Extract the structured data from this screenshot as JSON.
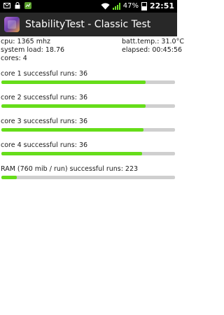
{
  "status_bar": {
    "battery_percent": "47%",
    "time": "22:51",
    "icons": [
      "mail-icon",
      "lock-icon",
      "app-notification-icon",
      "wifi-icon",
      "signal-icon",
      "battery-icon"
    ]
  },
  "action_bar": {
    "title": "StabilityTest - Classic Test"
  },
  "info": {
    "cpu": "cpu: 1365 mhz",
    "batt_temp": "batt.temp.: 31.0°C",
    "system_load": "system load: 18.76",
    "elapsed": "elapsed: 00:45:56",
    "cores": "cores: 4"
  },
  "sections": [
    {
      "label": "core 1 successful runs: 36",
      "progress": 0.83
    },
    {
      "label": "core 2 successful runs: 36",
      "progress": 0.83
    },
    {
      "label": "core 3 successful runs: 36",
      "progress": 0.82
    },
    {
      "label": "core 4 successful runs: 36",
      "progress": 0.81
    },
    {
      "label": "RAM (760 mib / run) successful runs: 223",
      "progress": 0.09
    }
  ],
  "colors": {
    "progress_fill": "#66dd1a",
    "progress_track": "#cfcfcf",
    "action_bar": "#282828"
  }
}
